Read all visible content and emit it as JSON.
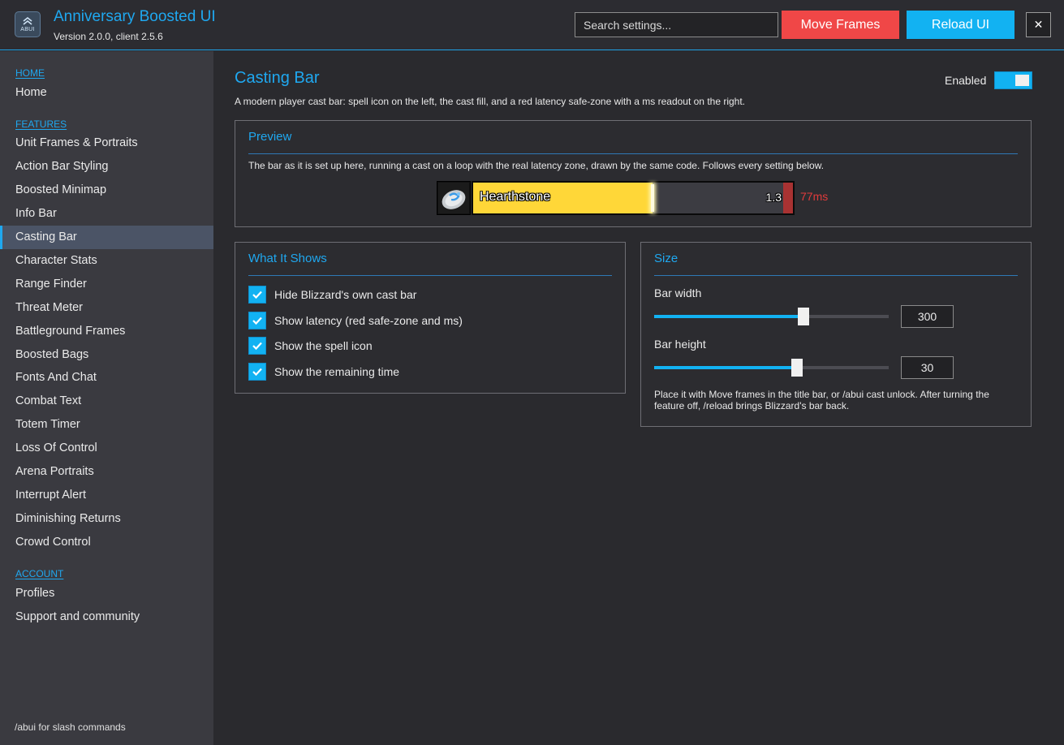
{
  "header": {
    "logo_text": "ABUI",
    "title": "Anniversary Boosted UI",
    "version": "Version 2.0.0, client 2.5.6",
    "search_placeholder": "Search settings...",
    "move_frames_label": "Move Frames",
    "reload_label": "Reload UI",
    "close_glyph": "✕"
  },
  "sidebar": {
    "sections": [
      {
        "label": "HOME",
        "items": [
          "Home"
        ]
      },
      {
        "label": "FEATURES",
        "items": [
          "Unit Frames & Portraits",
          "Action Bar Styling",
          "Boosted Minimap",
          "Info Bar",
          "Casting Bar",
          "Character Stats",
          "Range Finder",
          "Threat Meter",
          "Battleground Frames",
          "Boosted Bags",
          "Fonts And Chat",
          "Combat Text",
          "Totem Timer",
          "Loss Of Control",
          "Arena Portraits",
          "Interrupt Alert",
          "Diminishing Returns",
          "Crowd Control"
        ]
      },
      {
        "label": "ACCOUNT",
        "items": [
          "Profiles",
          "Support and community"
        ]
      }
    ],
    "active_item": "Casting Bar",
    "footer": "/abui for slash commands"
  },
  "main": {
    "title": "Casting Bar",
    "description": "A modern player cast bar: spell icon on the left, the cast fill, and a red latency safe-zone with a ms readout on the right.",
    "enabled_label": "Enabled",
    "enabled": true,
    "preview": {
      "title": "Preview",
      "description": "The bar as it is set up here, running a cast on a loop with the real latency zone, drawn by the same code.  Follows every setting below.",
      "spell_name": "Hearthstone",
      "remaining_time": "1.3",
      "latency_text": "77ms",
      "cast_progress": 0.56,
      "latency_fraction": 0.03,
      "fill_color": "#ffd738",
      "latency_color": "#a83232"
    },
    "what_it_shows": {
      "title": "What It Shows",
      "options": [
        {
          "label": "Hide Blizzard's own cast bar",
          "checked": true
        },
        {
          "label": "Show latency (red safe-zone and ms)",
          "checked": true
        },
        {
          "label": "Show the spell icon",
          "checked": true
        },
        {
          "label": "Show the remaining time",
          "checked": true
        }
      ]
    },
    "size": {
      "title": "Size",
      "bar_width_label": "Bar width",
      "bar_width_value": "300",
      "bar_width_fraction": 0.635,
      "bar_height_label": "Bar height",
      "bar_height_value": "30",
      "bar_height_fraction": 0.61,
      "note": "Place it with Move frames in the title bar, or /abui cast unlock.  After turning the feature off, /reload brings Blizzard's bar back."
    }
  },
  "colors": {
    "accent": "#1fa8f0",
    "danger_button": "#f04747",
    "primary_button": "#12b2f2"
  }
}
